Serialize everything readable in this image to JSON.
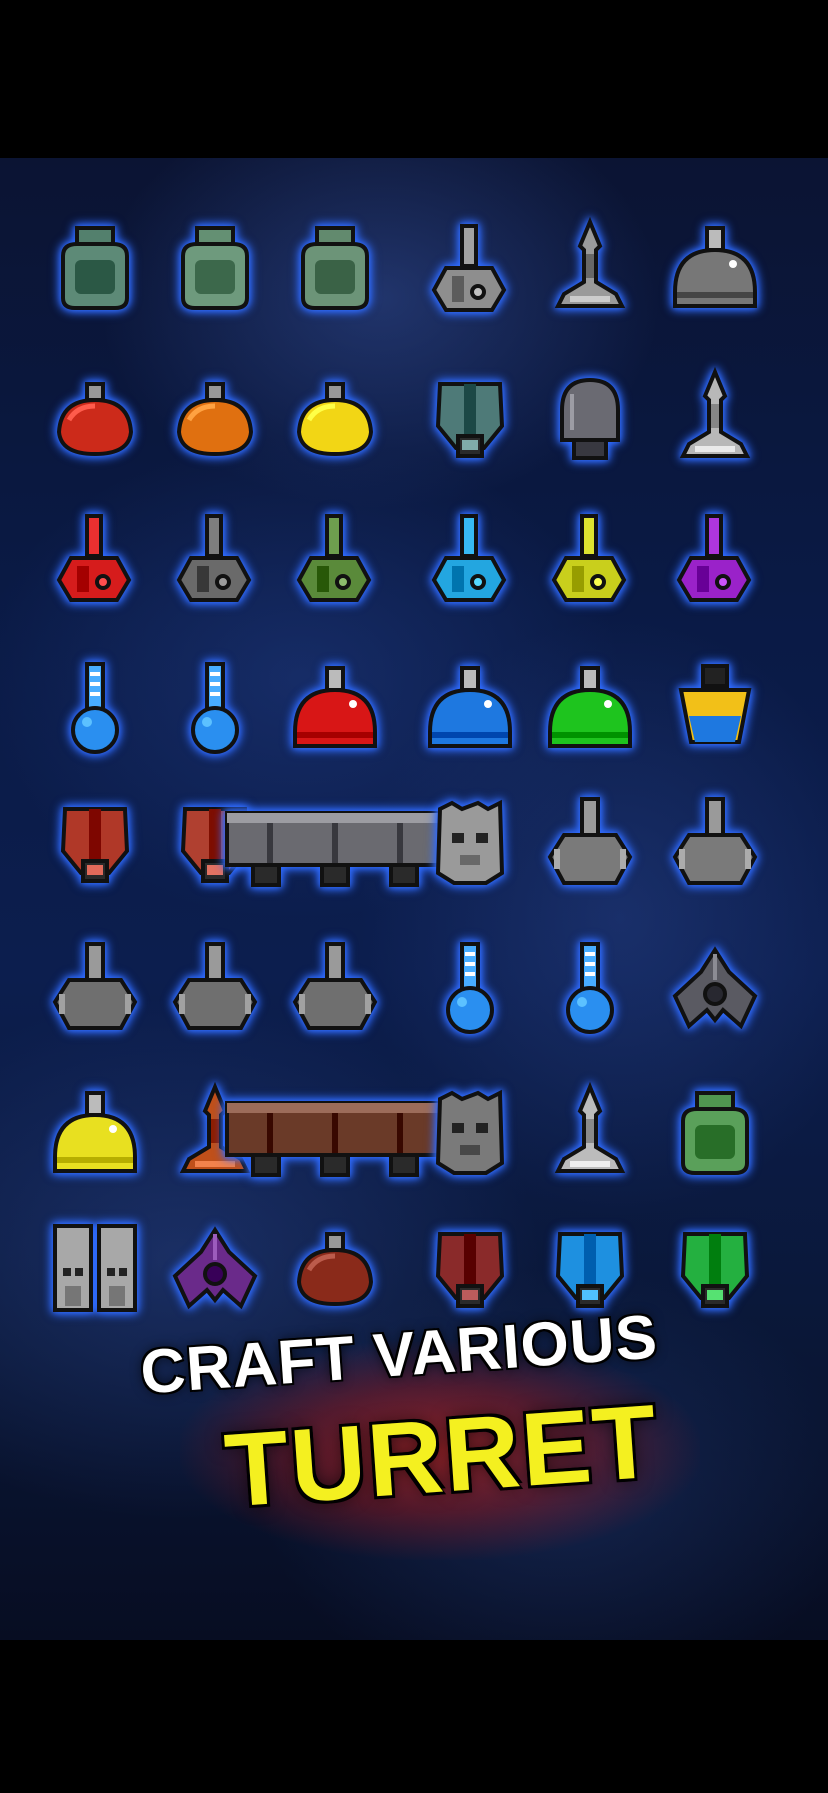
{
  "promo": {
    "line1": "CRAFT VARIOUS",
    "line2": "TURRET"
  },
  "colors": {
    "background": "#000000",
    "space": "#0a1a45",
    "glow": "#2f6bff",
    "line1_text": "#ffffff",
    "line2_text": "#f4f020",
    "banner_glow": "#ff2814"
  },
  "turrets": [
    {
      "row": 0,
      "col": 0,
      "shape": "bag",
      "color": "#5d8a77",
      "icon": "cauldron-turret-icon"
    },
    {
      "row": 0,
      "col": 1,
      "shape": "bag",
      "color": "#6e9a7d",
      "icon": "twin-pot-turret-icon"
    },
    {
      "row": 0,
      "col": 2,
      "shape": "bag",
      "color": "#6c9478",
      "icon": "jar-turret-icon"
    },
    {
      "row": 0,
      "col": 3,
      "shape": "needle",
      "color": "#8e8e8e",
      "icon": "gray-cannon-turret-icon"
    },
    {
      "row": 0,
      "col": 4,
      "shape": "spike",
      "color": "#9a9a9a",
      "icon": "spire-turret-icon"
    },
    {
      "row": 0,
      "col": 5,
      "shape": "dome",
      "color": "#777777",
      "icon": "gray-dome-turret-icon"
    },
    {
      "row": 1,
      "col": 0,
      "shape": "blob",
      "color": "#cc2a1a",
      "icon": "red-blob-turret-icon"
    },
    {
      "row": 1,
      "col": 1,
      "shape": "blob",
      "color": "#e07010",
      "icon": "orange-blob-turret-icon"
    },
    {
      "row": 1,
      "col": 2,
      "shape": "blob",
      "color": "#f2d615",
      "icon": "yellow-blob-turret-icon"
    },
    {
      "row": 1,
      "col": 3,
      "shape": "pod",
      "color": "#4e7a78",
      "icon": "teal-pod-turret-icon"
    },
    {
      "row": 1,
      "col": 4,
      "shape": "capsule",
      "color": "#6a6a72",
      "icon": "capsule-turret-icon"
    },
    {
      "row": 1,
      "col": 5,
      "shape": "spike",
      "color": "#b8b8b8",
      "icon": "silver-spire-turret-icon"
    },
    {
      "row": 2,
      "col": 0,
      "shape": "needle",
      "color": "#d61c1c",
      "icon": "red-cannon-turret-icon"
    },
    {
      "row": 2,
      "col": 1,
      "shape": "needle",
      "color": "#6a6a6a",
      "icon": "dark-cannon-turret-icon"
    },
    {
      "row": 2,
      "col": 2,
      "shape": "needle",
      "color": "#5a8a3a",
      "icon": "green-cannon-turret-icon"
    },
    {
      "row": 2,
      "col": 3,
      "shape": "needle",
      "color": "#23a6e0",
      "icon": "cyan-cannon-turret-icon"
    },
    {
      "row": 2,
      "col": 4,
      "shape": "needle",
      "color": "#c9cf1c",
      "icon": "lime-cannon-turret-icon"
    },
    {
      "row": 2,
      "col": 5,
      "shape": "needle",
      "color": "#9a22c9",
      "icon": "purple-cannon-turret-icon"
    },
    {
      "row": 3,
      "col": 0,
      "shape": "flask",
      "color": "#2a8ff0",
      "icon": "blue-flask-turret-icon"
    },
    {
      "row": 3,
      "col": 1,
      "shape": "flask",
      "color": "#2a8ff0",
      "icon": "blue-tube-turret-icon"
    },
    {
      "row": 3,
      "col": 2,
      "shape": "dome",
      "color": "#d81616",
      "icon": "red-dome-turret-icon"
    },
    {
      "row": 3,
      "col": 3,
      "shape": "dome",
      "color": "#1e78e0",
      "icon": "blue-dome-turret-icon"
    },
    {
      "row": 3,
      "col": 4,
      "shape": "dome",
      "color": "#1ec41e",
      "icon": "green-dome-turret-icon"
    },
    {
      "row": 3,
      "col": 5,
      "shape": "cup",
      "color": "#f2c018",
      "icon": "gold-cup-turret-icon"
    },
    {
      "row": 4,
      "col": 0,
      "shape": "pod",
      "color": "#b03828",
      "icon": "red-pod-turret-icon"
    },
    {
      "row": 4,
      "col": 1,
      "shape": "pod",
      "color": "#b04030",
      "icon": "rust-pod-turret-icon"
    },
    {
      "row": 4,
      "col": 2,
      "shape": "barrel",
      "color": "#6a6a70",
      "icon": "triple-barrel-turret-icon"
    },
    {
      "row": 4,
      "col": 3,
      "shape": "block",
      "color": "#9a9a9a",
      "icon": "skull-turret-icon"
    },
    {
      "row": 4,
      "col": 4,
      "shape": "gem",
      "color": "#7a7a7a",
      "icon": "red-fin-turret-icon"
    },
    {
      "row": 4,
      "col": 5,
      "shape": "gem",
      "color": "#7a7a7a",
      "icon": "blue-fin-turret-icon"
    },
    {
      "row": 5,
      "col": 0,
      "shape": "gem",
      "color": "#6f6f6f",
      "icon": "green-fin-turret-icon"
    },
    {
      "row": 5,
      "col": 1,
      "shape": "gem",
      "color": "#6f6f6f",
      "icon": "pink-fin-turret-icon"
    },
    {
      "row": 5,
      "col": 2,
      "shape": "gem",
      "color": "#6f6f6f",
      "icon": "yellow-fin-turret-icon"
    },
    {
      "row": 5,
      "col": 3,
      "shape": "flask",
      "color": "#2a8ff0",
      "icon": "small-blue-flask-turret-icon"
    },
    {
      "row": 5,
      "col": 4,
      "shape": "flask",
      "color": "#2a8ff0",
      "icon": "gray-neck-flask-turret-icon"
    },
    {
      "row": 5,
      "col": 5,
      "shape": "wing",
      "color": "#5a5a62",
      "icon": "winged-turret-icon"
    },
    {
      "row": 6,
      "col": 0,
      "shape": "dome",
      "color": "#e8e020",
      "icon": "yellow-dome-turret-icon"
    },
    {
      "row": 6,
      "col": 1,
      "shape": "spike",
      "color": "#c0501a",
      "icon": "flame-spire-turret-icon"
    },
    {
      "row": 6,
      "col": 2,
      "shape": "barrel",
      "color": "#6a3a28",
      "icon": "chest-turret-icon"
    },
    {
      "row": 6,
      "col": 3,
      "shape": "block",
      "color": "#7a7a7a",
      "icon": "gray-block-turret-icon"
    },
    {
      "row": 6,
      "col": 4,
      "shape": "spike",
      "color": "#bcbcbc",
      "icon": "claw-turret-icon"
    },
    {
      "row": 6,
      "col": 5,
      "shape": "bag",
      "color": "#5aa05a",
      "icon": "green-gem-turret-icon"
    },
    {
      "row": 7,
      "col": 0,
      "shape": "twin",
      "color": "#a8a8a8",
      "icon": "twin-skull-turret-icon"
    },
    {
      "row": 7,
      "col": 1,
      "shape": "wing",
      "color": "#6a2a8a",
      "icon": "purple-wing-turret-icon"
    },
    {
      "row": 7,
      "col": 2,
      "shape": "blob",
      "color": "#8a2a1a",
      "icon": "crimson-turret-icon"
    },
    {
      "row": 7,
      "col": 3,
      "shape": "pod",
      "color": "#8a2a2a",
      "icon": "dark-red-pod-turret-icon"
    },
    {
      "row": 7,
      "col": 4,
      "shape": "pod",
      "color": "#1e90e0",
      "icon": "blue-tower-turret-icon"
    },
    {
      "row": 7,
      "col": 5,
      "shape": "pod",
      "color": "#24b040",
      "icon": "green-tower-turret-icon"
    }
  ]
}
